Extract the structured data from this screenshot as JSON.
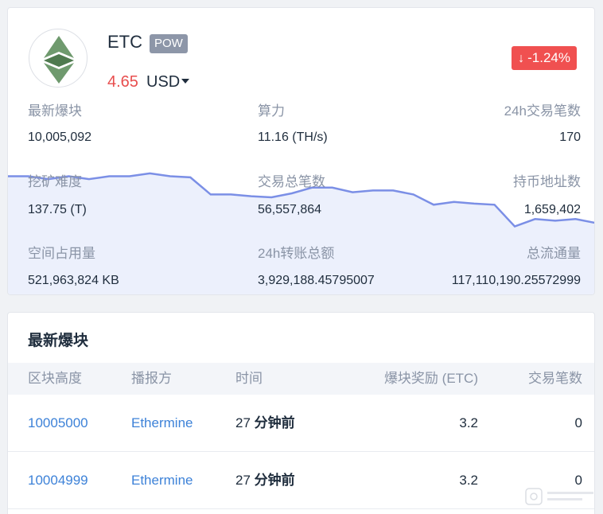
{
  "coin": {
    "name": "ETC",
    "tag": "POW",
    "price": "4.65",
    "currency": "USD",
    "change": "-1.24%",
    "change_direction": "down",
    "brand_color": "#6f9a6e",
    "down_color": "#f05050"
  },
  "stats": [
    {
      "label": "最新爆块",
      "value": "10,005,092"
    },
    {
      "label": "算力",
      "value": "11.16 (TH/s)"
    },
    {
      "label": "24h交易笔数",
      "value": "170"
    },
    {
      "label": "挖矿难度",
      "value": "137.75 (T)"
    },
    {
      "label": "交易总笔数",
      "value": "56,557,864"
    },
    {
      "label": "持币地址数",
      "value": "1,659,402"
    },
    {
      "label": "空间占用量",
      "value": "521,963,824 KB"
    },
    {
      "label": "24h转账总额",
      "value": "3,929,188.45795007"
    },
    {
      "label": "总流通量",
      "value": "117,110,190.25572999"
    }
  ],
  "chart_data": {
    "type": "area",
    "values": [
      5.3,
      5.3,
      5.25,
      5.3,
      5.25,
      5.3,
      5.3,
      5.35,
      5.3,
      5.28,
      4.98,
      4.98,
      4.95,
      4.93,
      5.0,
      5.1,
      5.1,
      5.02,
      5.05,
      5.05,
      4.98,
      4.8,
      4.85,
      4.82,
      4.8,
      4.42,
      4.55,
      4.52,
      4.55,
      4.48
    ],
    "ylim": [
      3.2,
      5.6
    ],
    "line_color": "#7b8fe6",
    "fill_color": "#e9edfc"
  },
  "latest_blocks": {
    "title": "最新爆块",
    "columns": [
      "区块高度",
      "播报方",
      "时间",
      "爆块奖励",
      "(ETC)",
      "交易笔数"
    ],
    "rows": [
      {
        "height": "10005000",
        "miner": "Ethermine",
        "time_num": "27",
        "time_unit": "分钟前",
        "reward": "3.2",
        "tx": "0"
      },
      {
        "height": "10004999",
        "miner": "Ethermine",
        "time_num": "27",
        "time_unit": "分钟前",
        "reward": "3.2",
        "tx": "0"
      }
    ]
  }
}
